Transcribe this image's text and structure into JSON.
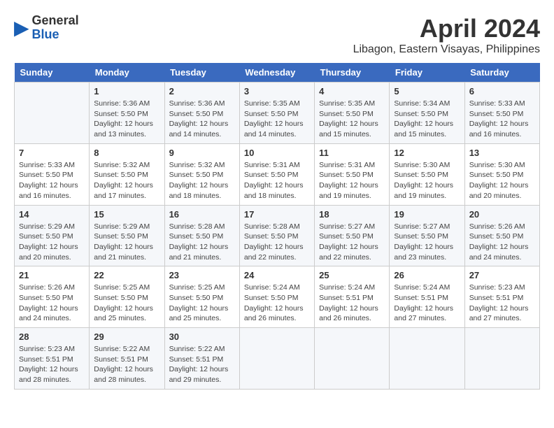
{
  "header": {
    "logo_general": "General",
    "logo_blue": "Blue",
    "title": "April 2024",
    "subtitle": "Libagon, Eastern Visayas, Philippines"
  },
  "calendar": {
    "days_of_week": [
      "Sunday",
      "Monday",
      "Tuesday",
      "Wednesday",
      "Thursday",
      "Friday",
      "Saturday"
    ],
    "weeks": [
      [
        {
          "day": "",
          "sunrise": "",
          "sunset": "",
          "daylight": ""
        },
        {
          "day": "1",
          "sunrise": "Sunrise: 5:36 AM",
          "sunset": "Sunset: 5:50 PM",
          "daylight": "Daylight: 12 hours and 13 minutes."
        },
        {
          "day": "2",
          "sunrise": "Sunrise: 5:36 AM",
          "sunset": "Sunset: 5:50 PM",
          "daylight": "Daylight: 12 hours and 14 minutes."
        },
        {
          "day": "3",
          "sunrise": "Sunrise: 5:35 AM",
          "sunset": "Sunset: 5:50 PM",
          "daylight": "Daylight: 12 hours and 14 minutes."
        },
        {
          "day": "4",
          "sunrise": "Sunrise: 5:35 AM",
          "sunset": "Sunset: 5:50 PM",
          "daylight": "Daylight: 12 hours and 15 minutes."
        },
        {
          "day": "5",
          "sunrise": "Sunrise: 5:34 AM",
          "sunset": "Sunset: 5:50 PM",
          "daylight": "Daylight: 12 hours and 15 minutes."
        },
        {
          "day": "6",
          "sunrise": "Sunrise: 5:33 AM",
          "sunset": "Sunset: 5:50 PM",
          "daylight": "Daylight: 12 hours and 16 minutes."
        }
      ],
      [
        {
          "day": "7",
          "sunrise": "Sunrise: 5:33 AM",
          "sunset": "Sunset: 5:50 PM",
          "daylight": "Daylight: 12 hours and 16 minutes."
        },
        {
          "day": "8",
          "sunrise": "Sunrise: 5:32 AM",
          "sunset": "Sunset: 5:50 PM",
          "daylight": "Daylight: 12 hours and 17 minutes."
        },
        {
          "day": "9",
          "sunrise": "Sunrise: 5:32 AM",
          "sunset": "Sunset: 5:50 PM",
          "daylight": "Daylight: 12 hours and 18 minutes."
        },
        {
          "day": "10",
          "sunrise": "Sunrise: 5:31 AM",
          "sunset": "Sunset: 5:50 PM",
          "daylight": "Daylight: 12 hours and 18 minutes."
        },
        {
          "day": "11",
          "sunrise": "Sunrise: 5:31 AM",
          "sunset": "Sunset: 5:50 PM",
          "daylight": "Daylight: 12 hours and 19 minutes."
        },
        {
          "day": "12",
          "sunrise": "Sunrise: 5:30 AM",
          "sunset": "Sunset: 5:50 PM",
          "daylight": "Daylight: 12 hours and 19 minutes."
        },
        {
          "day": "13",
          "sunrise": "Sunrise: 5:30 AM",
          "sunset": "Sunset: 5:50 PM",
          "daylight": "Daylight: 12 hours and 20 minutes."
        }
      ],
      [
        {
          "day": "14",
          "sunrise": "Sunrise: 5:29 AM",
          "sunset": "Sunset: 5:50 PM",
          "daylight": "Daylight: 12 hours and 20 minutes."
        },
        {
          "day": "15",
          "sunrise": "Sunrise: 5:29 AM",
          "sunset": "Sunset: 5:50 PM",
          "daylight": "Daylight: 12 hours and 21 minutes."
        },
        {
          "day": "16",
          "sunrise": "Sunrise: 5:28 AM",
          "sunset": "Sunset: 5:50 PM",
          "daylight": "Daylight: 12 hours and 21 minutes."
        },
        {
          "day": "17",
          "sunrise": "Sunrise: 5:28 AM",
          "sunset": "Sunset: 5:50 PM",
          "daylight": "Daylight: 12 hours and 22 minutes."
        },
        {
          "day": "18",
          "sunrise": "Sunrise: 5:27 AM",
          "sunset": "Sunset: 5:50 PM",
          "daylight": "Daylight: 12 hours and 22 minutes."
        },
        {
          "day": "19",
          "sunrise": "Sunrise: 5:27 AM",
          "sunset": "Sunset: 5:50 PM",
          "daylight": "Daylight: 12 hours and 23 minutes."
        },
        {
          "day": "20",
          "sunrise": "Sunrise: 5:26 AM",
          "sunset": "Sunset: 5:50 PM",
          "daylight": "Daylight: 12 hours and 24 minutes."
        }
      ],
      [
        {
          "day": "21",
          "sunrise": "Sunrise: 5:26 AM",
          "sunset": "Sunset: 5:50 PM",
          "daylight": "Daylight: 12 hours and 24 minutes."
        },
        {
          "day": "22",
          "sunrise": "Sunrise: 5:25 AM",
          "sunset": "Sunset: 5:50 PM",
          "daylight": "Daylight: 12 hours and 25 minutes."
        },
        {
          "day": "23",
          "sunrise": "Sunrise: 5:25 AM",
          "sunset": "Sunset: 5:50 PM",
          "daylight": "Daylight: 12 hours and 25 minutes."
        },
        {
          "day": "24",
          "sunrise": "Sunrise: 5:24 AM",
          "sunset": "Sunset: 5:50 PM",
          "daylight": "Daylight: 12 hours and 26 minutes."
        },
        {
          "day": "25",
          "sunrise": "Sunrise: 5:24 AM",
          "sunset": "Sunset: 5:51 PM",
          "daylight": "Daylight: 12 hours and 26 minutes."
        },
        {
          "day": "26",
          "sunrise": "Sunrise: 5:24 AM",
          "sunset": "Sunset: 5:51 PM",
          "daylight": "Daylight: 12 hours and 27 minutes."
        },
        {
          "day": "27",
          "sunrise": "Sunrise: 5:23 AM",
          "sunset": "Sunset: 5:51 PM",
          "daylight": "Daylight: 12 hours and 27 minutes."
        }
      ],
      [
        {
          "day": "28",
          "sunrise": "Sunrise: 5:23 AM",
          "sunset": "Sunset: 5:51 PM",
          "daylight": "Daylight: 12 hours and 28 minutes."
        },
        {
          "day": "29",
          "sunrise": "Sunrise: 5:22 AM",
          "sunset": "Sunset: 5:51 PM",
          "daylight": "Daylight: 12 hours and 28 minutes."
        },
        {
          "day": "30",
          "sunrise": "Sunrise: 5:22 AM",
          "sunset": "Sunset: 5:51 PM",
          "daylight": "Daylight: 12 hours and 29 minutes."
        },
        {
          "day": "",
          "sunrise": "",
          "sunset": "",
          "daylight": ""
        },
        {
          "day": "",
          "sunrise": "",
          "sunset": "",
          "daylight": ""
        },
        {
          "day": "",
          "sunrise": "",
          "sunset": "",
          "daylight": ""
        },
        {
          "day": "",
          "sunrise": "",
          "sunset": "",
          "daylight": ""
        }
      ]
    ]
  }
}
